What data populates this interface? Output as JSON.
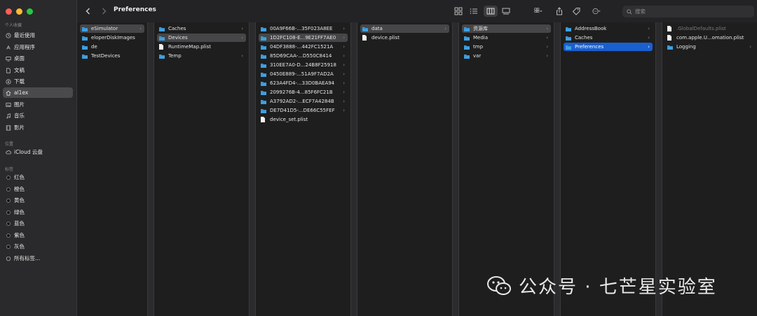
{
  "window": {
    "title": "Preferences"
  },
  "search": {
    "placeholder": "搜索"
  },
  "sidebar": {
    "header_personal": "个人收藏",
    "personal": [
      {
        "label": "最近使用",
        "icon": "clock-icon"
      },
      {
        "label": "应用程序",
        "icon": "apps-icon"
      },
      {
        "label": "桌面",
        "icon": "desktop-icon"
      },
      {
        "label": "文稿",
        "icon": "document-icon"
      },
      {
        "label": "下载",
        "icon": "download-icon"
      },
      {
        "label": "al1ex",
        "icon": "home-icon",
        "selected": true
      },
      {
        "label": "图片",
        "icon": "photo-icon"
      },
      {
        "label": "音乐",
        "icon": "music-icon"
      },
      {
        "label": "影片",
        "icon": "film-icon"
      }
    ],
    "header_location": "位置",
    "location": [
      {
        "label": "iCloud 云盘",
        "icon": "cloud-icon"
      }
    ],
    "header_tags": "标签",
    "tags": [
      {
        "label": "红色"
      },
      {
        "label": "橙色"
      },
      {
        "label": "黄色"
      },
      {
        "label": "绿色"
      },
      {
        "label": "蓝色"
      },
      {
        "label": "紫色"
      },
      {
        "label": "灰色"
      }
    ],
    "all_tags": "所有标签..."
  },
  "columns": [
    {
      "items": [
        {
          "label": "eSimulator",
          "type": "folder",
          "state": "gray",
          "chevron": "›"
        },
        {
          "label": "eloperDiskImages",
          "type": "folder"
        },
        {
          "label": "de",
          "type": "folder"
        },
        {
          "label": "TestDevices",
          "type": "folder"
        }
      ]
    },
    {
      "items": [
        {
          "label": "Caches",
          "type": "folder",
          "chevron": "›"
        },
        {
          "label": "Devices",
          "type": "folder",
          "state": "gray",
          "chevron": "›"
        },
        {
          "label": "RuntimeMap.plist",
          "type": "file"
        },
        {
          "label": "Temp",
          "type": "folder",
          "chevron": "›"
        }
      ]
    },
    {
      "items": [
        {
          "label": "00A9F66B-...35F023A8EE",
          "type": "folder",
          "chevron": "›"
        },
        {
          "label": "1D2FC108-E...9E21FF7AE0",
          "type": "folder",
          "state": "gray",
          "chevron": "›"
        },
        {
          "label": "04DF3888-...442FC1521A",
          "type": "folder",
          "chevron": "›"
        },
        {
          "label": "85D69CAA-...D550C8414",
          "type": "folder",
          "chevron": "›"
        },
        {
          "label": "310EE7A0-D...24B8F25918",
          "type": "folder",
          "chevron": "›"
        },
        {
          "label": "0450E889-...51A9F7AD2A",
          "type": "folder",
          "chevron": "›"
        },
        {
          "label": "623A4FD4-...33D0BAEA94",
          "type": "folder",
          "chevron": "›"
        },
        {
          "label": "2099276B-4...85F6FC21B",
          "type": "folder",
          "chevron": "›"
        },
        {
          "label": "A3792AD2-...ECF7A4284B",
          "type": "folder",
          "chevron": "›"
        },
        {
          "label": "DE7D41D5-...DE66C55FEF",
          "type": "folder",
          "chevron": "›"
        },
        {
          "label": "device_set.plist",
          "type": "file"
        }
      ]
    },
    {
      "items": [
        {
          "label": "data",
          "type": "folder",
          "state": "gray",
          "chevron": "›"
        },
        {
          "label": "device.plist",
          "type": "file"
        }
      ]
    },
    {
      "items": [
        {
          "label": "资源库",
          "type": "folder",
          "state": "gray",
          "chevron": "›"
        },
        {
          "label": "Media",
          "type": "folder",
          "chevron": "›"
        },
        {
          "label": "tmp",
          "type": "folder",
          "chevron": "›"
        },
        {
          "label": "var",
          "type": "folder",
          "chevron": "›"
        }
      ]
    },
    {
      "items": [
        {
          "label": "AddressBook",
          "type": "folder",
          "chevron": "›"
        },
        {
          "label": "Caches",
          "type": "folder",
          "chevron": "›"
        },
        {
          "label": "Preferences",
          "type": "folder",
          "state": "blue",
          "chevron": "›"
        }
      ]
    },
    {
      "items": [
        {
          "label": ".GlobalDefaults.plist",
          "type": "file",
          "state": "dim"
        },
        {
          "label": "com.apple.U...omation.plist",
          "type": "file"
        },
        {
          "label": "Logging",
          "type": "folder",
          "chevron": "›"
        }
      ]
    }
  ],
  "watermark": {
    "text": "公众号 · 七芒星实验室"
  },
  "colors": {
    "selection_blue": "#1a5fd0",
    "folder": "#3fa0e0",
    "background": "#1e1e1e",
    "sidebar": "#2a2a2c"
  }
}
